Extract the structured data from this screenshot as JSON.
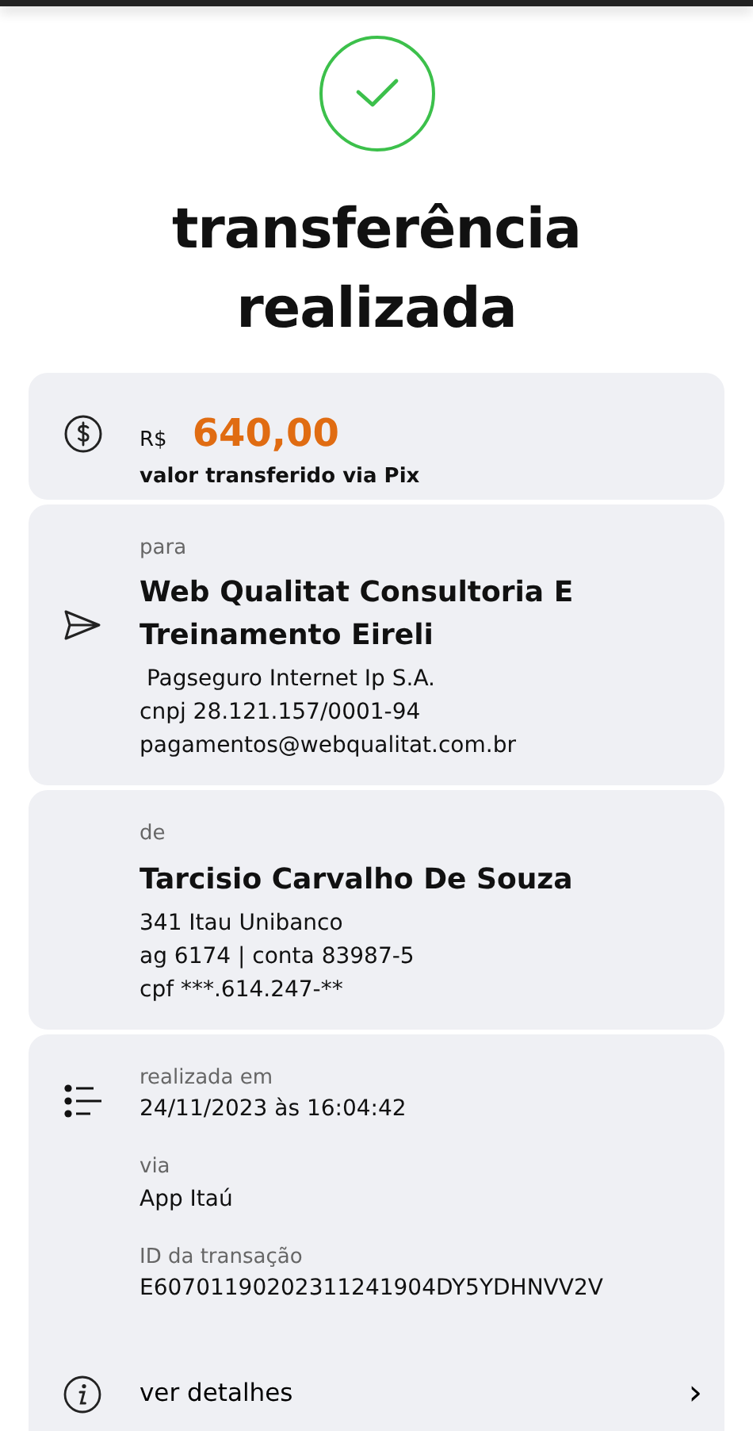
{
  "title": "transferência realizada",
  "amount": {
    "currency": "R$",
    "value": "640,00",
    "caption": "valor transferido via Pix"
  },
  "recipient": {
    "label": "para",
    "name": "Web Qualitat Consultoria E Treinamento Eireli",
    "lines": [
      " Pagseguro Internet Ip S.A.",
      "cnpj 28.121.157/0001-94",
      "pagamentos@webqualitat.com.br"
    ]
  },
  "sender": {
    "label": "de",
    "name": "Tarcisio Carvalho De Souza",
    "lines": [
      "341 Itau Unibanco",
      "ag 6174 | conta 83987-5",
      "cpf ***.614.247-**"
    ]
  },
  "details": [
    {
      "label": "realizada em",
      "value": "24/11/2023 às 16:04:42"
    },
    {
      "label": "via",
      "value": "App Itaú"
    },
    {
      "label": "ID da transação",
      "value": "E60701190202311241904DY5YDHNVV2V"
    }
  ],
  "more": {
    "label": "ver detalhes",
    "chevron": "›"
  }
}
